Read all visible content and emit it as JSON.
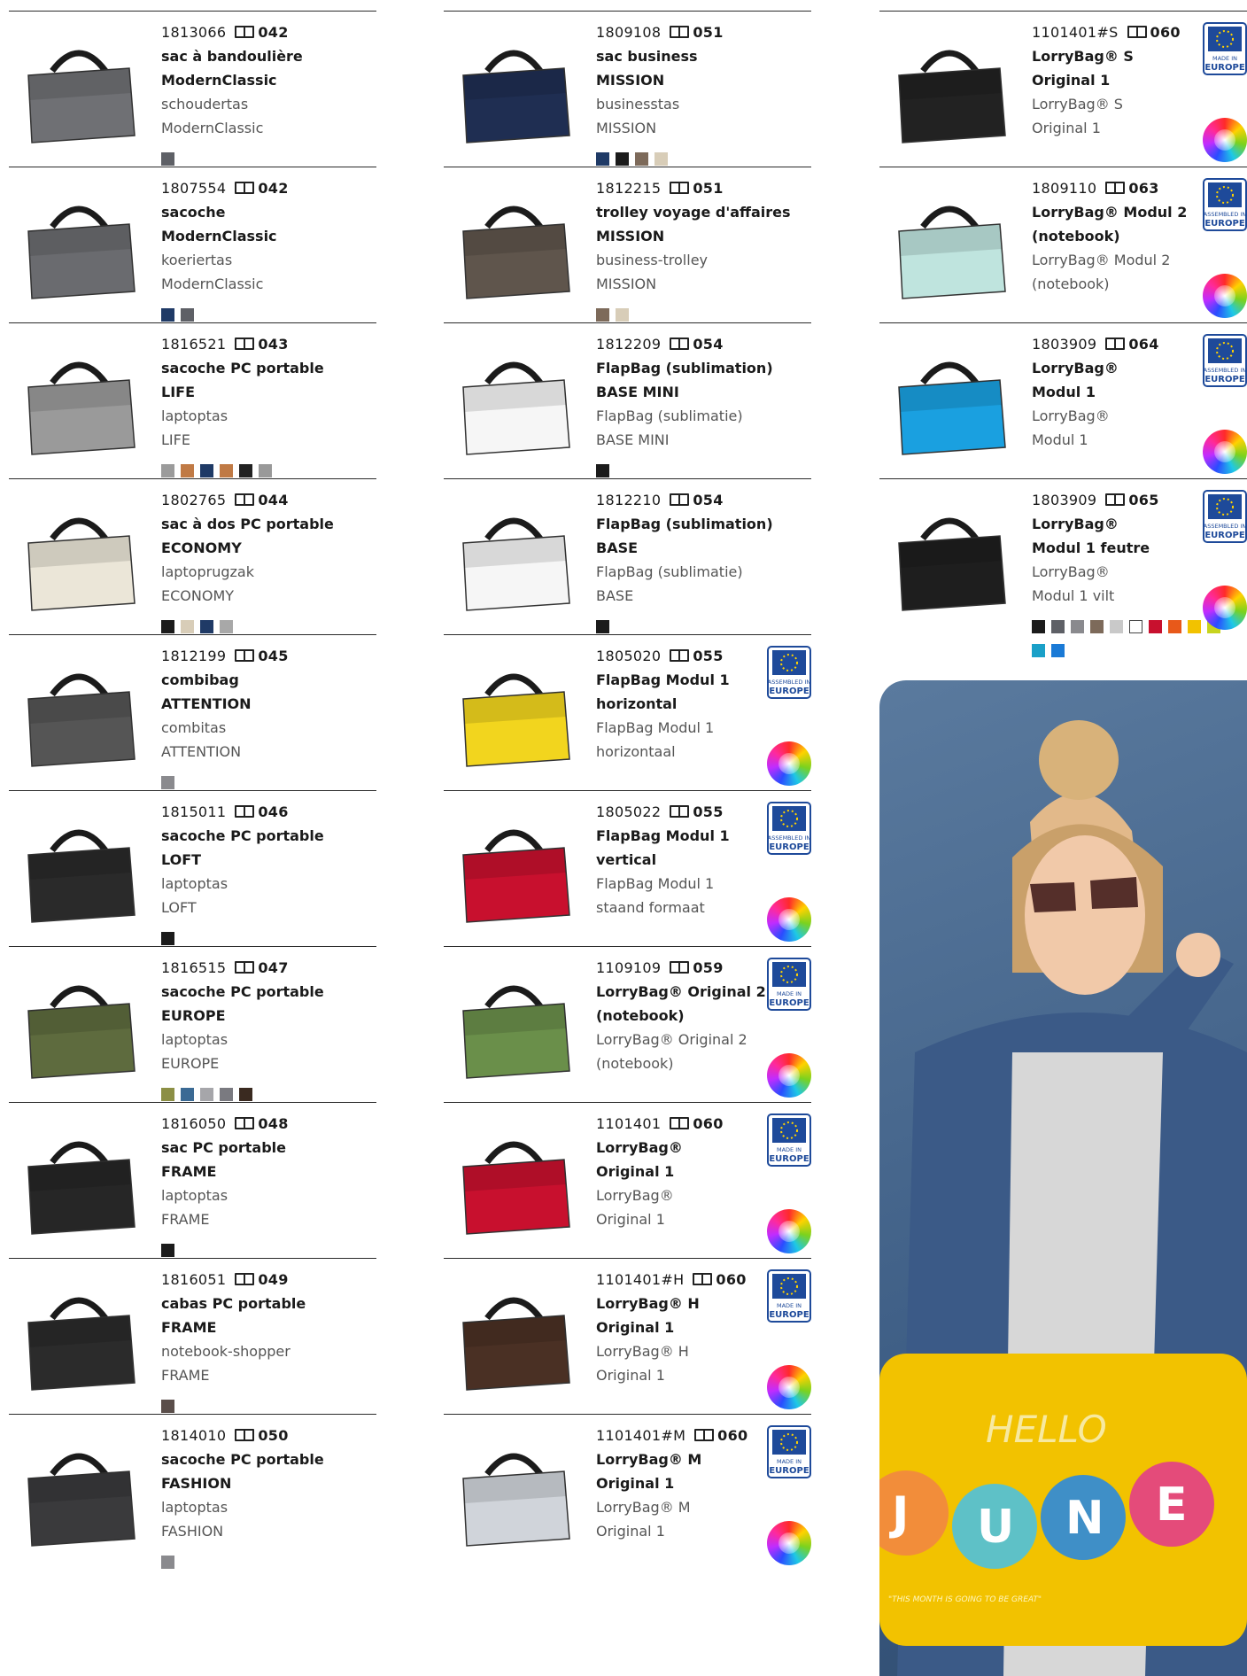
{
  "columns": [
    {
      "items": [
        {
          "code": "1813066",
          "page": "042",
          "title1": "sac à bandoulière",
          "title2": "ModernClassic",
          "nl1": "schoudertas",
          "nl2": "ModernClassic",
          "swatches": [
            "#5e6066"
          ],
          "bag": "#6f7074"
        },
        {
          "code": "1807554",
          "page": "042",
          "title1": "sacoche",
          "title2": "ModernClassic",
          "nl1": "koeriertas",
          "nl2": "ModernClassic",
          "swatches": [
            "#1f3a66",
            "#5e6066"
          ],
          "bag": "#6a6b6f"
        },
        {
          "code": "1816521",
          "page": "043",
          "title1": "sacoche PC portable",
          "title2": "LIFE",
          "nl1": "laptoptas",
          "nl2": "LIFE",
          "swatches": [
            "#9b9b9b",
            "#c07a45",
            "#1f3a66",
            "#c07a45",
            "#222",
            "#999"
          ],
          "bag": "#9a9a9a"
        },
        {
          "code": "1802765",
          "page": "044",
          "title1": "sac à dos PC portable",
          "title2": "ECONOMY",
          "nl1": "laptoprugzak",
          "nl2": "ECONOMY",
          "swatches": [
            "#1b1b1b",
            "#d8cdb8",
            "#1f3a66",
            "#a8a8a8"
          ],
          "bag": "#ebe6d8"
        },
        {
          "code": "1812199",
          "page": "045",
          "title1": "combibag",
          "title2": "ATTENTION",
          "nl1": "combitas",
          "nl2": "ATTENTION",
          "swatches": [
            "#8a8a8e"
          ],
          "bag": "#555"
        },
        {
          "code": "1815011",
          "page": "046",
          "title1": "sacoche PC portable",
          "title2": "LOFT",
          "nl1": "laptoptas",
          "nl2": "LOFT",
          "swatches": [
            "#1b1b1b"
          ],
          "bag": "#2a2a2a"
        },
        {
          "code": "1816515",
          "page": "047",
          "title1": "sacoche PC portable",
          "title2": "EUROPE",
          "nl1": "laptoptas",
          "nl2": "EUROPE",
          "swatches": [
            "#8c8f45",
            "#3b6a94",
            "#a6a6aa",
            "#7a7a80",
            "#3a2a20"
          ],
          "bag": "#5e6b3e"
        },
        {
          "code": "1816050",
          "page": "048",
          "title1": "sac PC portable",
          "title2": "FRAME",
          "nl1": "laptoptas",
          "nl2": "FRAME",
          "swatches": [
            "#1b1b1b"
          ],
          "bag": "#262626"
        },
        {
          "code": "1816051",
          "page": "049",
          "title1": "cabas PC portable",
          "title2": "FRAME",
          "nl1": "notebook-shopper",
          "nl2": "FRAME",
          "swatches": [
            "#5a4e4a"
          ],
          "bag": "#2b2b2b"
        },
        {
          "code": "1814010",
          "page": "050",
          "title1": "sacoche PC portable",
          "title2": "FASHION",
          "nl1": "laptoptas",
          "nl2": "FASHION",
          "swatches": [
            "#8a8a8e"
          ],
          "bag": "#3a3a3c"
        }
      ]
    },
    {
      "items": [
        {
          "code": "1809108",
          "page": "051",
          "title1": "sac business",
          "title2": "MISSION",
          "nl1": "businesstas",
          "nl2": "MISSION",
          "swatches": [
            "#1f3a66",
            "#1b1b1b",
            "#7d6a5a",
            "#d8cdb8"
          ],
          "bag": "#1f2e52"
        },
        {
          "code": "1812215",
          "page": "051",
          "title1": "trolley voyage d'affaires",
          "title2": "MISSION",
          "nl1": "business-trolley",
          "nl2": "MISSION",
          "swatches": [
            "#7d6a5a",
            "#d8cdb8"
          ],
          "bag": "#5f554c"
        },
        {
          "code": "1812209",
          "page": "054",
          "title1": "FlapBag (sublimation)",
          "title2": "BASE MINI",
          "nl1": "FlapBag (sublimatie)",
          "nl2": "BASE MINI",
          "swatches": [
            "#1b1b1b"
          ],
          "bag": "#f6f6f6"
        },
        {
          "code": "1812210",
          "page": "054",
          "title1": "FlapBag (sublimation)",
          "title2": "BASE",
          "nl1": "FlapBag (sublimatie)",
          "nl2": "BASE",
          "swatches": [
            "#1b1b1b"
          ],
          "bag": "#f6f6f6"
        },
        {
          "code": "1805020",
          "page": "055",
          "title1": "FlapBag Modul 1",
          "title2": "horizontal",
          "nl1": "FlapBag Modul 1",
          "nl2": "horizontaal",
          "swatches": [],
          "bag": "#f2d51e",
          "eu": "ASSEMBLED IN"
        },
        {
          "code": "1805022",
          "page": "055",
          "title1": "FlapBag Modul 1",
          "title2": "vertical",
          "nl1": "FlapBag Modul 1",
          "nl2": "staand formaat",
          "swatches": [],
          "bag": "#c8102e",
          "eu": "ASSEMBLED IN"
        },
        {
          "code": "1109109",
          "page": "059",
          "title1": "LorryBag® Original 2",
          "title2": "(notebook)",
          "nl1": "LorryBag® Original 2",
          "nl2": "(notebook)",
          "swatches": [],
          "bag": "#6a8f4a",
          "eu": "MADE IN"
        },
        {
          "code": "1101401",
          "page": "060",
          "title1": "LorryBag®",
          "title2": "Original 1",
          "nl1": "LorryBag®",
          "nl2": "Original 1",
          "swatches": [],
          "bag": "#c8102e",
          "eu": "MADE IN"
        },
        {
          "code": "1101401#H",
          "page": "060",
          "title1": "LorryBag® H",
          "title2": "Original 1",
          "nl1": "LorryBag® H",
          "nl2": "Original 1",
          "swatches": [],
          "bag": "#4a3024",
          "eu": "MADE IN"
        },
        {
          "code": "1101401#M",
          "page": "060",
          "title1": "LorryBag® M",
          "title2": "Original 1",
          "nl1": "LorryBag® M",
          "nl2": "Original 1",
          "swatches": [],
          "bag": "#d0d4da",
          "eu": "MADE IN"
        }
      ]
    },
    {
      "items": [
        {
          "code": "1101401#S",
          "page": "060",
          "title1": "LorryBag® S",
          "title2": "Original 1",
          "nl1": "LorryBag® S",
          "nl2": "Original 1",
          "swatches": [],
          "bag": "#222",
          "eu": "MADE IN"
        },
        {
          "code": "1809110",
          "page": "063",
          "title1": "LorryBag® Modul 2",
          "title2": "(notebook)",
          "nl1": "LorryBag® Modul 2",
          "nl2": "(notebook)",
          "swatches": [],
          "bag": "#bfe4de",
          "eu": "ASSEMBLED IN"
        },
        {
          "code": "1803909",
          "page": "064",
          "title1": "LorryBag®",
          "title2": "Modul 1",
          "nl1": "LorryBag®",
          "nl2": "Modul 1",
          "swatches": [],
          "bag": "#1aa0e0",
          "eu": "ASSEMBLED IN"
        },
        {
          "code": "1803909",
          "page": "065",
          "title1": "LorryBag®",
          "title2": "Modul 1 feutre",
          "nl1": "LorryBag®",
          "nl2": "Modul 1 vilt",
          "swatches": [
            "#1b1b1b",
            "#5e6066",
            "#8a8a8e",
            "#7d6a5a",
            "#c9c9c9",
            "#ffffff",
            "#c8102e",
            "#e8591a",
            "#f2c200",
            "#c7d41e",
            "#1aa0c8",
            "#1a7ad6"
          ],
          "bag": "#1e1e1e",
          "eu": "ASSEMBLED IN"
        }
      ]
    }
  ],
  "eu_label": "EUROPE",
  "photo": {
    "bag_text1": "HELLO",
    "bag_letters": [
      "J",
      "U",
      "N",
      "E"
    ],
    "bag_text2": "\"THIS MONTH IS GOING TO BE GREAT\""
  }
}
